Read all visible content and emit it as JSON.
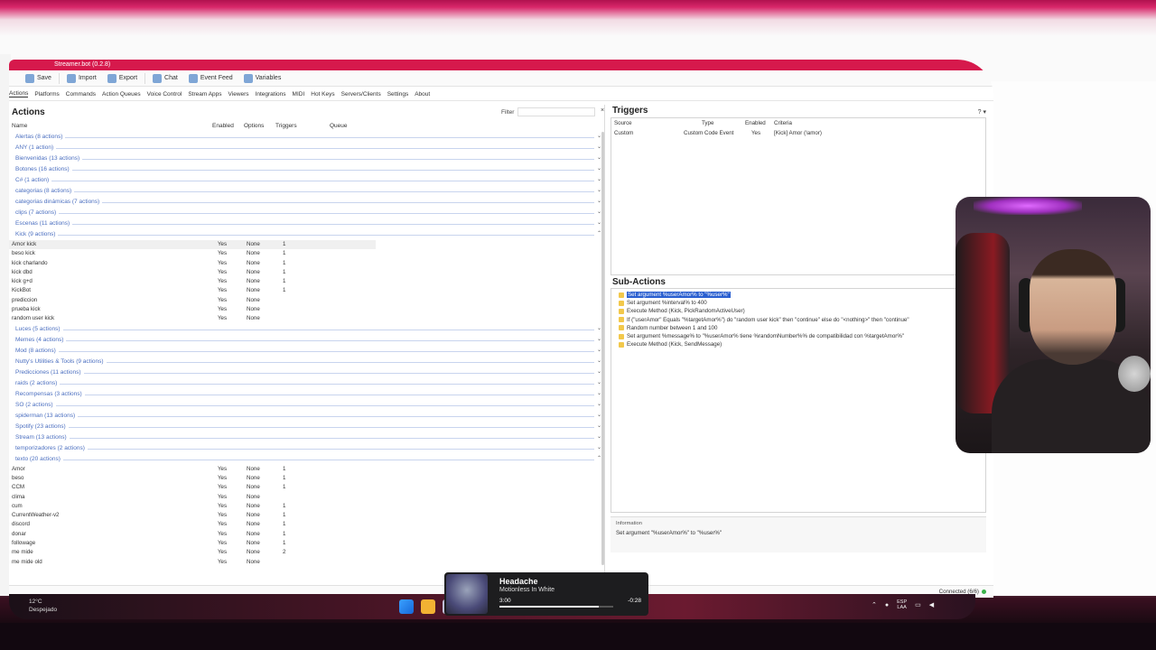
{
  "window": {
    "title": "Streamer.bot (0.2.8)"
  },
  "toolbar": {
    "save": "Save",
    "import": "Import",
    "export": "Export",
    "chat": "Chat",
    "event_feed": "Event Feed",
    "variables": "Variables"
  },
  "menu": [
    "Actions",
    "Platforms",
    "Commands",
    "Action Queues",
    "Voice Control",
    "Stream Apps",
    "Viewers",
    "Integrations",
    "MIDI",
    "Hot Keys",
    "Servers/Clients",
    "Settings",
    "About"
  ],
  "actions": {
    "title": "Actions",
    "filter_label": "Filter",
    "columns": {
      "name": "Name",
      "enabled": "Enabled",
      "options": "Options",
      "triggers": "Triggers",
      "queue": "Queue"
    },
    "groups_top": [
      "Alertas (8 actions)",
      "ANY (1 action)",
      "Bienvenidas (13 actions)",
      "Botones (16 actions)",
      "C# (1 action)",
      "categorias (8 actions)",
      "categorias dinámicas (7 actions)",
      "clips (7 actions)",
      "Escenas (11 actions)",
      "Kick (9 actions)"
    ],
    "kick_items": [
      {
        "name": "Amor kick",
        "enabled": "Yes",
        "options": "None",
        "triggers": "1"
      },
      {
        "name": "beso kick",
        "enabled": "Yes",
        "options": "None",
        "triggers": "1"
      },
      {
        "name": "kick charlando",
        "enabled": "Yes",
        "options": "None",
        "triggers": "1"
      },
      {
        "name": "kick dbd",
        "enabled": "Yes",
        "options": "None",
        "triggers": "1"
      },
      {
        "name": "kick g+d",
        "enabled": "Yes",
        "options": "None",
        "triggers": "1"
      },
      {
        "name": "KickBot",
        "enabled": "Yes",
        "options": "None",
        "triggers": "1"
      },
      {
        "name": "prediccion",
        "enabled": "Yes",
        "options": "None",
        "triggers": ""
      },
      {
        "name": "prueba kick",
        "enabled": "Yes",
        "options": "None",
        "triggers": ""
      },
      {
        "name": "random user kick",
        "enabled": "Yes",
        "options": "None",
        "triggers": ""
      }
    ],
    "groups_mid": [
      "Luces (5 actions)",
      "Memes (4 actions)",
      "Mod (8 actions)",
      "Nutty's Utilities & Tools (9 actions)",
      "Predicciones (11 actions)",
      "raids (2 actions)",
      "Recompensas (3 actions)",
      "SO (2 actions)",
      "spiderman (13 actions)",
      "Spotify (23 actions)",
      "Stream (13 actions)",
      "temporizadores (2 actions)",
      "texto (20 actions)"
    ],
    "texto_items": [
      {
        "name": "Amor",
        "enabled": "Yes",
        "options": "None",
        "triggers": "1"
      },
      {
        "name": "beso",
        "enabled": "Yes",
        "options": "None",
        "triggers": "1"
      },
      {
        "name": "CCM",
        "enabled": "Yes",
        "options": "None",
        "triggers": "1"
      },
      {
        "name": "clima",
        "enabled": "Yes",
        "options": "None",
        "triggers": ""
      },
      {
        "name": "cum",
        "enabled": "Yes",
        "options": "None",
        "triggers": "1"
      },
      {
        "name": "CurrentWeather-v2",
        "enabled": "Yes",
        "options": "None",
        "triggers": "1"
      },
      {
        "name": "discord",
        "enabled": "Yes",
        "options": "None",
        "triggers": "1"
      },
      {
        "name": "donar",
        "enabled": "Yes",
        "options": "None",
        "triggers": "1"
      },
      {
        "name": "followage",
        "enabled": "Yes",
        "options": "None",
        "triggers": "1"
      },
      {
        "name": "me mide",
        "enabled": "Yes",
        "options": "None",
        "triggers": "2"
      },
      {
        "name": "me mide old",
        "enabled": "Yes",
        "options": "None",
        "triggers": ""
      }
    ]
  },
  "triggers": {
    "title": "Triggers",
    "columns": {
      "source": "Source",
      "type": "Type",
      "enabled": "Enabled",
      "criteria": "Criteria"
    },
    "rows": [
      {
        "source": "Custom",
        "type": "Custom Code Event",
        "enabled": "Yes",
        "criteria": "[Kick] Amor (!amor)"
      }
    ]
  },
  "subactions": {
    "title": "Sub-Actions",
    "rows": [
      "Set argument %userAmor% to \"%user%\"",
      "Set argument %interval% to 400",
      "Execute Method (Kick, PickRandomActiveUser)",
      "If (\"userAmor\" Equals \"%targetAmor%\") do \"random user kick\" then \"continue\" else do \"<nothing>\" then \"continue\"",
      "Random number between 1 and 100",
      "Set argument %message% to \"%userAmor% tiene %randomNumber%% de compatibilidad con %targetAmor%\"",
      "Execute Method (Kick, SendMessage)"
    ],
    "info_label": "Information",
    "info_text": "Set argument \"%userAmor%\" to \"%user%\""
  },
  "status": {
    "connected": "Connected (6/6)"
  },
  "taskbar": {
    "weather": "12°C",
    "weather_sub": "Despejado",
    "lang": "ESP",
    "lang2": "LAA"
  },
  "now_playing": {
    "title": "Headache",
    "artist": "Motionless In White",
    "elapsed": "3:00",
    "remaining": "-0:28",
    "progress": 0.87
  }
}
